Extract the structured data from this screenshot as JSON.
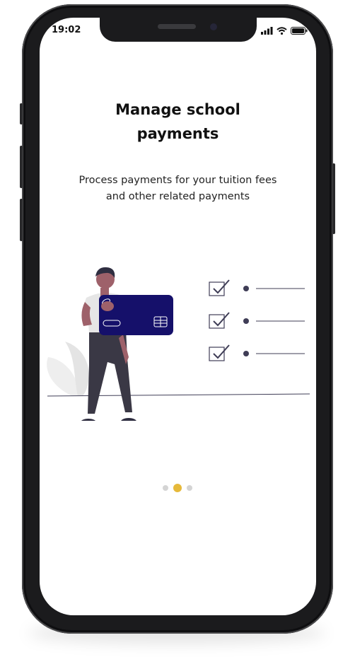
{
  "status_bar": {
    "time": "19:02",
    "icons": [
      "signal-icon",
      "wifi-icon",
      "battery-icon"
    ]
  },
  "onboarding": {
    "title_line1": "Manage school",
    "title_line2": "payments",
    "subtitle_line1": "Process payments for your tuition fees",
    "subtitle_line2": "and other related payments",
    "illustration": "person-holding-card-checklist-illustration"
  },
  "pagination": {
    "count": 3,
    "active_index": 1,
    "active_color": "#e6b93a",
    "inactive_color": "#d4d4d4"
  },
  "colors": {
    "card": "#15106a",
    "checklist_line": "#3f3d56"
  }
}
